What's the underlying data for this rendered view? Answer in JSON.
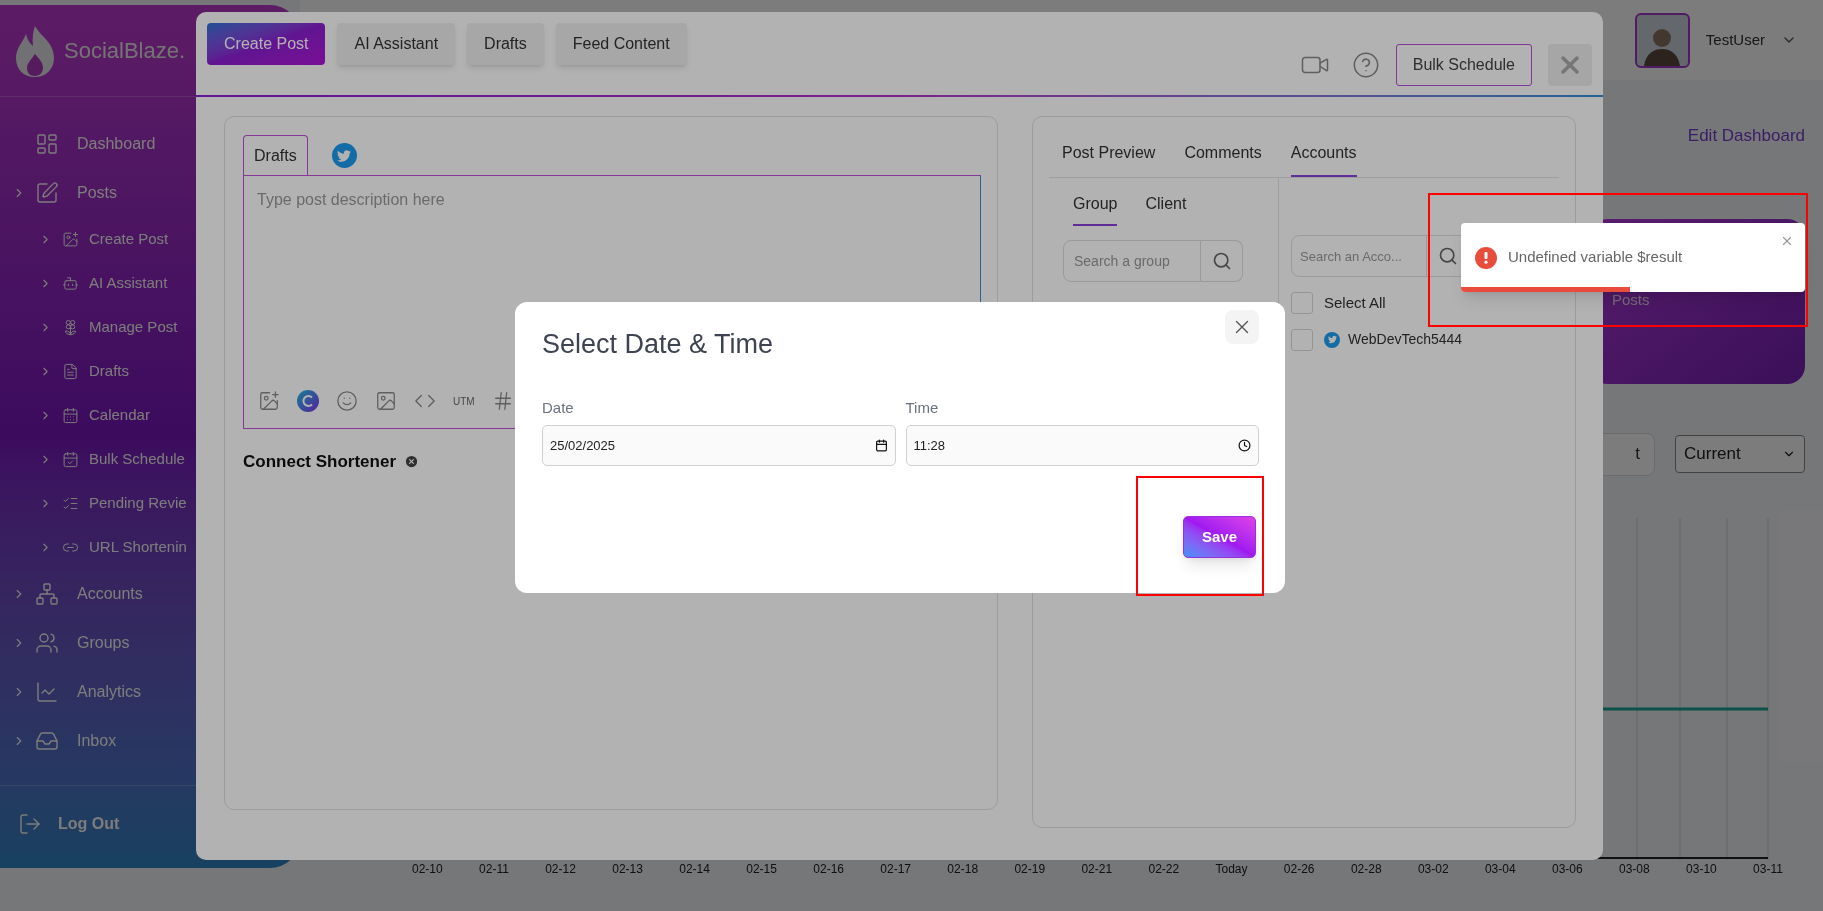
{
  "sidebar": {
    "brand": "SocialBlaze.",
    "items": [
      {
        "label": "Dashboard",
        "expandable": false
      },
      {
        "label": "Posts",
        "expandable": true,
        "children": [
          {
            "label": "Create Post",
            "expandable": true
          },
          {
            "label": "AI Assistant",
            "expandable": true
          },
          {
            "label": "Manage Post",
            "expandable": true
          },
          {
            "label": "Drafts",
            "expandable": true
          },
          {
            "label": "Calendar",
            "expandable": true
          },
          {
            "label": "Bulk Schedule",
            "expandable": true
          },
          {
            "label": "Pending Revie",
            "expandable": true
          },
          {
            "label": "URL Shortenin",
            "expandable": true
          }
        ]
      },
      {
        "label": "Accounts",
        "expandable": true
      },
      {
        "label": "Groups",
        "expandable": true
      },
      {
        "label": "Analytics",
        "expandable": true
      },
      {
        "label": "Inbox",
        "expandable": true
      }
    ],
    "logout": "Log Out"
  },
  "header": {
    "user_name": "TestUser"
  },
  "dashboard": {
    "edit_link": "Edit Dashboard",
    "card_label": "Posts",
    "filter_button": "t",
    "period_select": "Current",
    "chart_axis_labels": [
      "02-10",
      "02-11",
      "02-12",
      "02-13",
      "02-14",
      "02-15",
      "02-16",
      "02-17",
      "02-18",
      "02-19",
      "02-21",
      "02-22",
      "Today",
      "02-26",
      "02-28",
      "03-02",
      "03-04",
      "03-06",
      "03-08",
      "03-10",
      "03-11"
    ]
  },
  "composer": {
    "tabs": [
      {
        "label": "Create Post",
        "selected": true
      },
      {
        "label": "AI Assistant",
        "selected": false
      },
      {
        "label": "Drafts",
        "selected": false
      },
      {
        "label": "Feed Content",
        "selected": false
      }
    ],
    "bulk_schedule": "Bulk Schedule",
    "editor_tabs": [
      {
        "kind": "text",
        "label": "Drafts",
        "selected": true
      },
      {
        "kind": "network",
        "selected": false
      }
    ],
    "editor": {
      "placeholder": "Type post description here"
    },
    "utm_label": "UTM",
    "shortener_label": "Connect Shortener"
  },
  "side_panel": {
    "tabs": [
      {
        "label": "Post Preview",
        "selected": false
      },
      {
        "label": "Comments",
        "selected": false
      },
      {
        "label": "Accounts",
        "selected": true
      }
    ],
    "subtabs": [
      {
        "label": "Group",
        "selected": true
      },
      {
        "label": "Client",
        "selected": false
      }
    ],
    "group_search": {
      "placeholder": "Search a group"
    },
    "account_search": {
      "placeholder": "Search an Acco..."
    },
    "select_all": {
      "label": "Select All",
      "checked": false
    },
    "accounts": [
      {
        "name": "WebDevTech5444",
        "checked": false
      }
    ]
  },
  "dialog": {
    "title": "Select Date & Time",
    "fields": [
      {
        "kind": "date",
        "label": "Date",
        "value": "25/02/2025"
      },
      {
        "kind": "time",
        "label": "Time",
        "value": "11:28"
      }
    ],
    "save": "Save"
  },
  "toast": {
    "message": "Undefined variable $result",
    "level": 0.49
  }
}
